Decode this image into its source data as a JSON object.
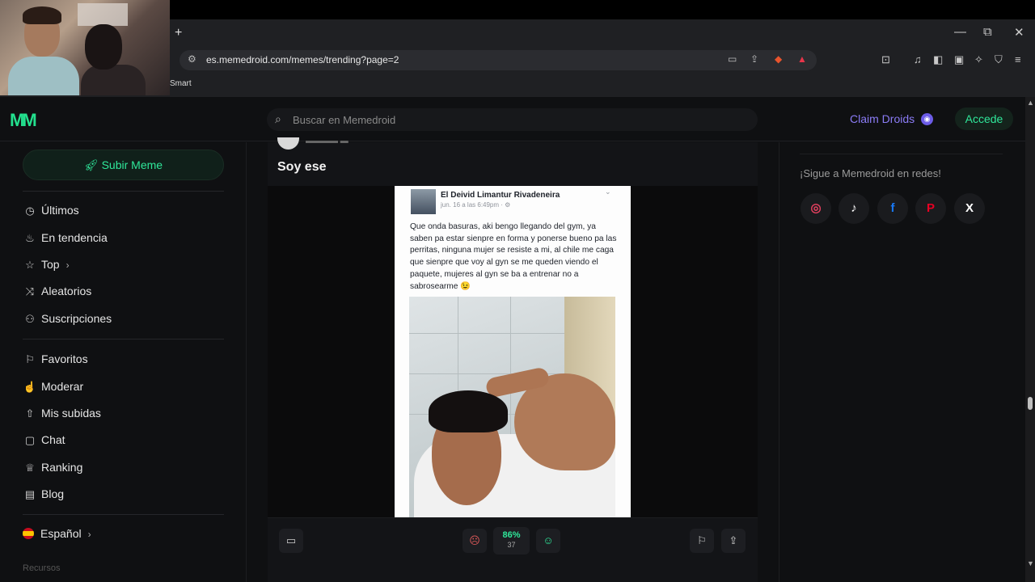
{
  "browser": {
    "new_tab_label": "+",
    "url": "es.memedroid.com/memes/trending?page=2",
    "bookmark_label": "Smart",
    "window_controls": [
      "—",
      "⧉",
      "✕"
    ]
  },
  "site": {
    "logo_text": "MM",
    "search_placeholder": "Buscar en Memedroid",
    "claim_label": "Claim Droids",
    "login_label": "Accede",
    "accent_color": "#2fe79a",
    "claim_color": "#8b7cf6"
  },
  "sidebar": {
    "upload_label": "Subir Meme",
    "items": [
      {
        "label": "Últimos",
        "icon": "clock-icon"
      },
      {
        "label": "En tendencia",
        "icon": "flame-icon"
      },
      {
        "label": "Top",
        "icon": "star-icon"
      },
      {
        "label": "Aleatorios",
        "icon": "shuffle-icon"
      },
      {
        "label": "Suscripciones",
        "icon": "users-icon"
      },
      {
        "label": "Favoritos",
        "icon": "bookmark-icon"
      },
      {
        "label": "Moderar",
        "icon": "thumb-icon"
      },
      {
        "label": "Mis subidas",
        "icon": "upload-icon"
      },
      {
        "label": "Chat",
        "icon": "chat-icon"
      },
      {
        "label": "Ranking",
        "icon": "ranking-icon"
      },
      {
        "label": "Blog",
        "icon": "blog-icon"
      }
    ],
    "language_label": "Español",
    "footer_label": "Recursos"
  },
  "post": {
    "title": "Soy ese",
    "fb": {
      "name": "El Deivid Limantur Rivadeneira",
      "date": "jun. 16 a las 6:49pm · ⚙",
      "text": "Que onda basuras, aki bengo llegando del gym, ya saben pa estar sienpre en forma y ponerse bueno pa las perritas, ninguna mujer se resiste a mi, al chile me caga que sienpre que voy al gyn se me queden viendo el paquete, mujeres al gyn se ba a entrenar no a sabrosearme 😉"
    },
    "score_percent": "86%",
    "vote_count": "37"
  },
  "right": {
    "follow_text": "¡Sigue a Memedroid en redes!",
    "socials": [
      "instagram-icon",
      "tiktok-icon",
      "facebook-icon",
      "pinterest-icon",
      "x-icon"
    ]
  }
}
